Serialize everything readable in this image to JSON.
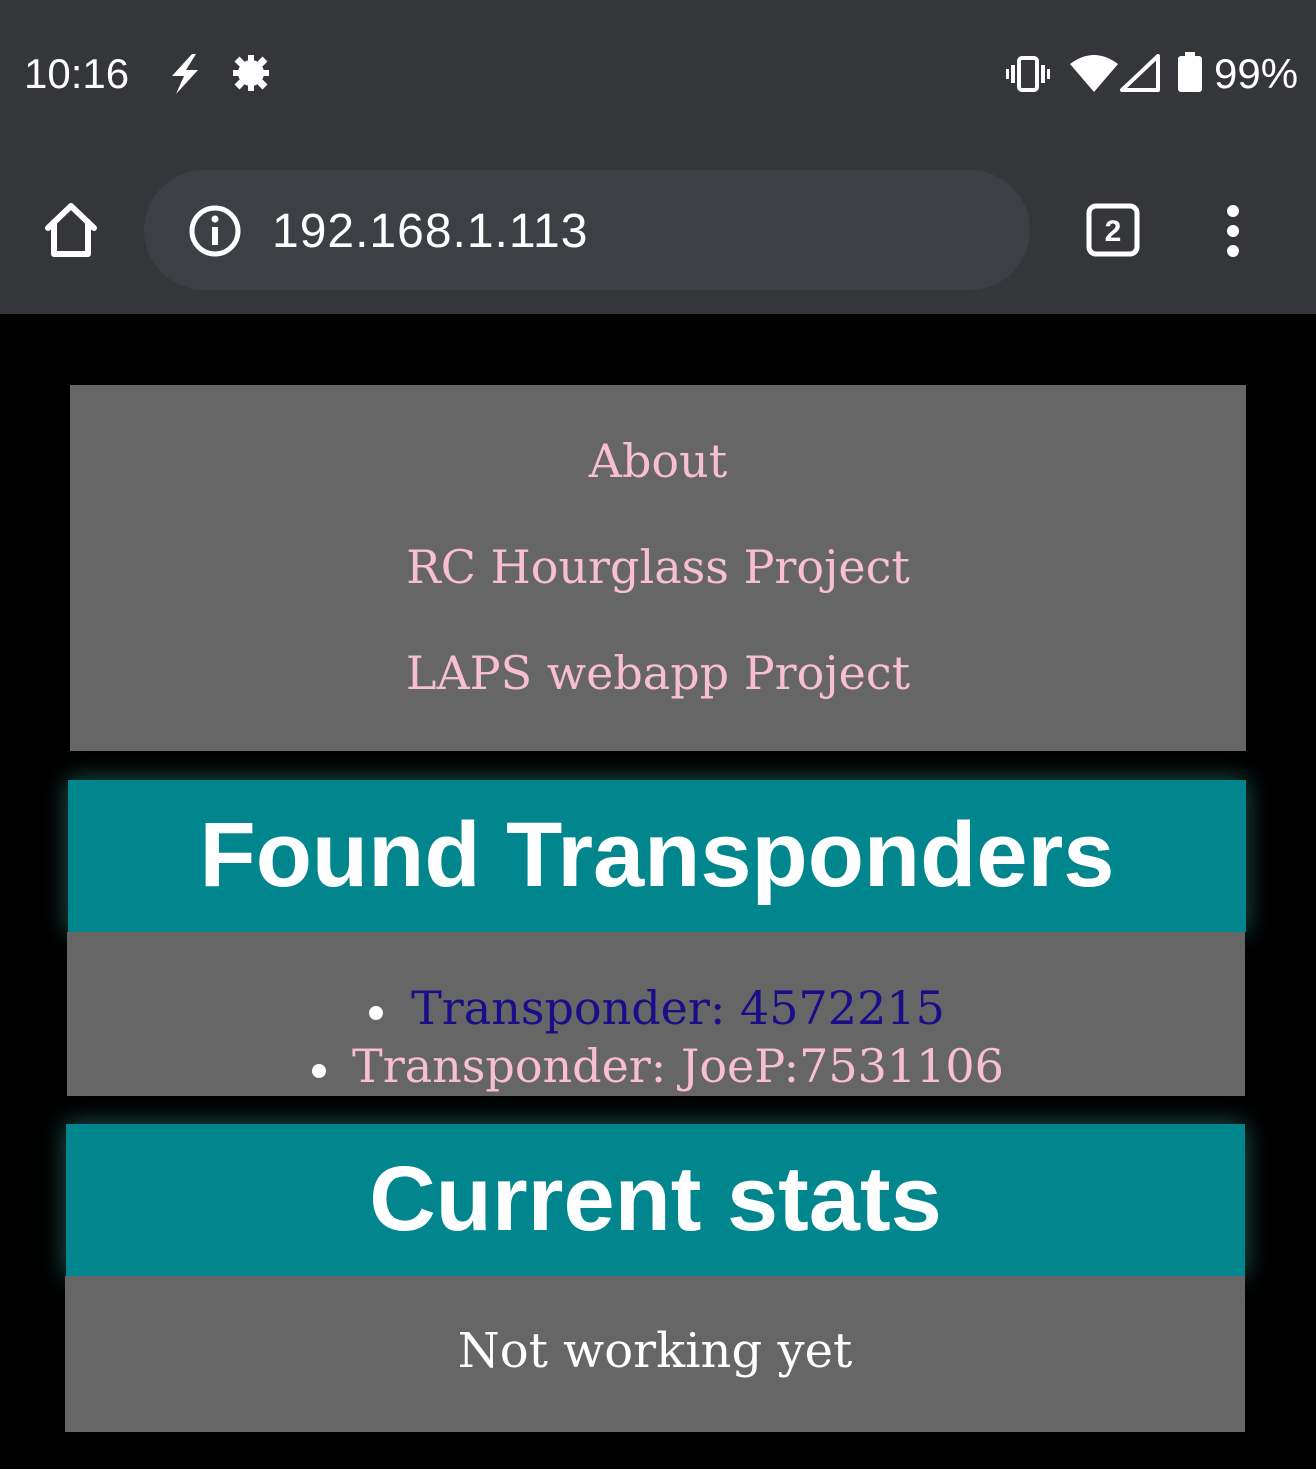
{
  "status_bar": {
    "time": "10:16",
    "battery_text": "99%",
    "icons": [
      "flash-icon",
      "settings-gear-icon",
      "vibrate-icon",
      "wifi-icon",
      "cell-signal-icon",
      "battery-icon"
    ]
  },
  "browser": {
    "url": "192.168.1.113",
    "tab_count": "2",
    "icons": [
      "home-icon",
      "info-icon",
      "tab-switcher-icon",
      "more-menu-icon"
    ]
  },
  "nav": {
    "links": [
      "About",
      "RC Hourglass Project",
      "LAPS webapp Project"
    ]
  },
  "transponders": {
    "heading": "Found Transponders",
    "items": [
      "Transponder: 4572215",
      "Transponder: JoeP:7531106"
    ]
  },
  "stats": {
    "heading": "Current stats",
    "text": "Not working yet"
  },
  "colors": {
    "chrome_bg": "#35363a",
    "page_bg": "#000000",
    "panel_bg": "#666666",
    "header_bg": "#02868e",
    "link_pink": "#f8bfd0",
    "visited_link": "#1a0d87"
  }
}
